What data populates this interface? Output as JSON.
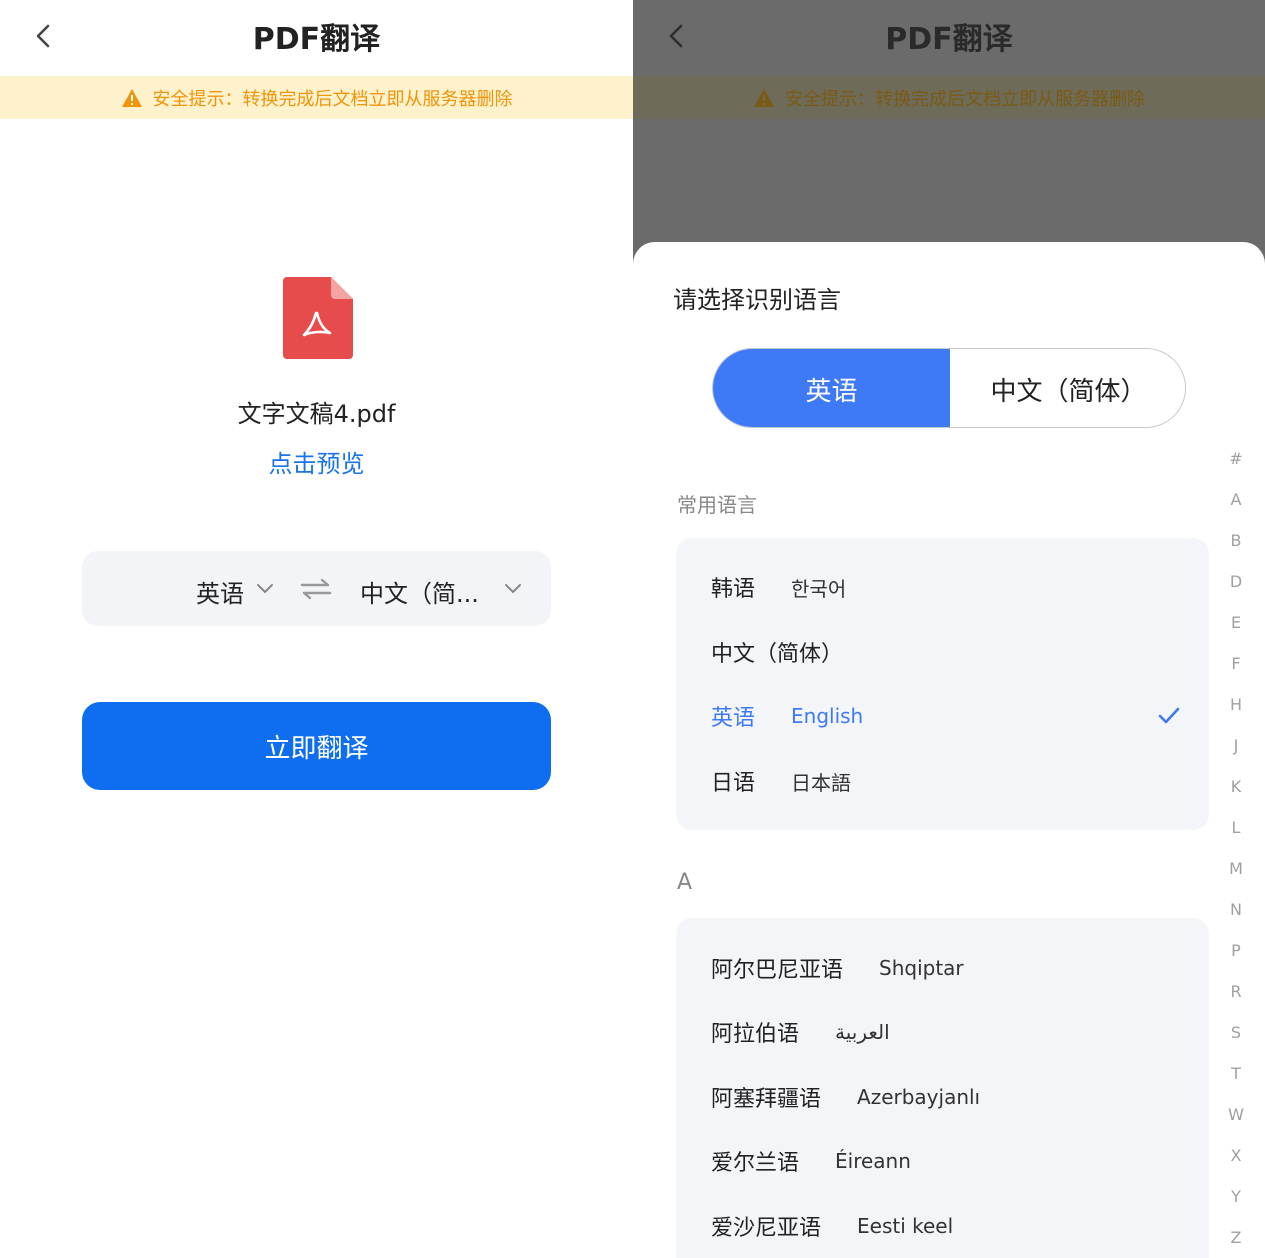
{
  "left": {
    "header": {
      "title": "PDF翻译",
      "back_icon": "chevron-left-icon"
    },
    "notice": {
      "text": "安全提示：转换完成后文档立即从服务器删除",
      "icon": "warning-icon"
    },
    "file": {
      "icon": "pdf-file-icon",
      "name": "文字文稿4.pdf",
      "preview_label": "点击预览"
    },
    "language_bar": {
      "from": "英语",
      "to": "中文（简...",
      "swap_icon": "swap-arrows-icon"
    },
    "translate_button": "立即翻译"
  },
  "right": {
    "header": {
      "title": "PDF翻译"
    },
    "notice": {
      "text": "安全提示：转换完成后文档立即从服务器删除"
    },
    "sheet": {
      "title": "请选择识别语言",
      "toggle": {
        "left": "英语",
        "right": "中文（简体）",
        "active": "left"
      },
      "common_label": "常用语言",
      "common_languages": [
        {
          "zh": "韩语",
          "native": "한국어"
        },
        {
          "zh": "中文（简体）",
          "native": ""
        },
        {
          "zh": "英语",
          "native": "English",
          "selected": true
        },
        {
          "zh": "日语",
          "native": "日本語"
        }
      ],
      "section_a_label": "A",
      "a_languages": [
        {
          "zh": "阿尔巴尼亚语",
          "native": "Shqiptar"
        },
        {
          "zh": "阿拉伯语",
          "native": "العربية"
        },
        {
          "zh": "阿塞拜疆语",
          "native": "Azerbayjanlı"
        },
        {
          "zh": "爱尔兰语",
          "native": "Éireann"
        },
        {
          "zh": "爱沙尼亚语",
          "native": "Eesti keel"
        }
      ],
      "alphabet_index": [
        "#",
        "A",
        "B",
        "D",
        "E",
        "F",
        "H",
        "J",
        "K",
        "L",
        "M",
        "N",
        "P",
        "R",
        "S",
        "T",
        "W",
        "X",
        "Y",
        "Z"
      ]
    }
  },
  "colors": {
    "accent": "#0f6ef0",
    "selected": "#3f7af6",
    "notice_text": "#f0940a",
    "notice_bg": "#fdf2cc",
    "pdf_red": "#e74c4c"
  }
}
